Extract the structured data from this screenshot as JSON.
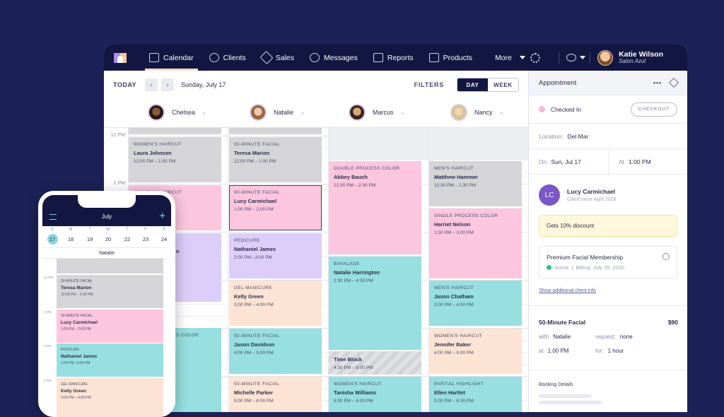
{
  "nav": {
    "items": [
      {
        "label": "Calendar",
        "icon": "calendar-icon",
        "active": true
      },
      {
        "label": "Clients",
        "icon": "clients-icon"
      },
      {
        "label": "Sales",
        "icon": "tag-icon"
      },
      {
        "label": "Messages",
        "icon": "chat-icon"
      },
      {
        "label": "Reports",
        "icon": "bar-chart-icon"
      },
      {
        "label": "Products",
        "icon": "shopping-bag-icon"
      }
    ],
    "more_label": "More",
    "user": {
      "name": "Katie Wilson",
      "salon": "Salon Azul"
    }
  },
  "toolbar": {
    "today_label": "TODAY",
    "prev_icon": "chevron-left-icon",
    "next_icon": "chevron-right-icon",
    "date": "Sunday, July 17",
    "filters_label": "FILTERS",
    "view_day": "DAY",
    "view_week": "WEEK",
    "selected_view": "DAY"
  },
  "staff": [
    "Chelsea",
    "Natalie",
    "Marcus",
    "Nancy"
  ],
  "time_labels": [
    "12 PM",
    "1 PM"
  ],
  "appointments": {
    "chelsea": [
      {
        "service": "Women's Haircut",
        "client": "Laura Johnson",
        "time": "12:00 PM – 1:00 PM"
      },
      {
        "service": "Women's Haircut",
        "client": "",
        "time": ""
      },
      {
        "service": "",
        "client": "n",
        "time": ""
      },
      {
        "service": "s Color",
        "client": "",
        "time": ""
      }
    ],
    "natalie": [
      {
        "service": "50-Minute Facial",
        "client": "Teresa Marion",
        "time": "12:00 PM – 1:00 PM"
      },
      {
        "service": "50-Minute Facial",
        "client": "Lucy Carmichael",
        "time": "1:00 PM – 2:00 PM"
      },
      {
        "service": "Pedicure",
        "client": "Nathaniel James",
        "time": "2:00 PM –3:00 PM"
      },
      {
        "service": "Gel Manicure",
        "client": "Kelly Green",
        "time": "3:00 PM – 4:00 PM"
      },
      {
        "service": "50-Minute Facial",
        "client": "Jason Davidson",
        "time": "4:00 PM – 5:00 PM"
      },
      {
        "service": "50-Minute Facial",
        "client": "Michelle Parker",
        "time": "5:00 PM – 6:00 PM"
      }
    ],
    "marcus": [
      {
        "service": "Double Process Color",
        "client": "Abbey Bauch",
        "time": "12:30 PM – 2:30 PM"
      },
      {
        "service": "Bayalage",
        "client": "Natalie Harrington",
        "time": "2:30 PM – 4:30 PM"
      },
      {
        "service": "",
        "client": "Time Block",
        "time": "4:30 PM – 5:00 PM"
      },
      {
        "service": "Women's Haircut",
        "client": "Tanisha Williams",
        "time": "5:00 PM – 6:00 PM"
      }
    ],
    "nancy": [
      {
        "service": "Men's Haircut",
        "client": "Matthew Hammer",
        "time": "12:30 PM – 1:30 PM"
      },
      {
        "service": "Single Process Color",
        "client": "Harriet Nelson",
        "time": "1:30 PM – 3:00 PM"
      },
      {
        "service": "Men's Haircut",
        "client": "Jason Chatham",
        "time": "3:00 PM – 4:00 PM"
      },
      {
        "service": "Women's Haircut",
        "client": "Jennifer Baker",
        "time": "4:00 PM – 5:00 PM"
      },
      {
        "service": "Partial Highlight",
        "client": "Ellen Hartlet",
        "time": "5:00 PM – 6:30 PM"
      }
    ]
  },
  "panel": {
    "title": "Appointment",
    "more_icon": "ellipsis-icon",
    "edit_icon": "pencil-icon",
    "status": "Checked In",
    "status_color": "#fcb8d4",
    "checkout_label": "CHECKOUT",
    "location_label": "Location:",
    "location": "Del Mar",
    "on_label": "On",
    "date": "Sun, Jul 17",
    "at_label": "At",
    "time": "1:00 PM",
    "client": {
      "initials": "LC",
      "name": "Lucy Carmichael",
      "since": "Client since April 2018"
    },
    "discount": "Gets 10% discount",
    "membership": {
      "title": "Premium Facial Membership",
      "status": "Active",
      "sep": "|",
      "billing": "Billing: July 25, 2020"
    },
    "more_info_link": "Show additional client info",
    "service": {
      "name": "50-Minute Facial",
      "price": "$90",
      "with_label": "with",
      "with": "Natalie",
      "request_label": "request:",
      "request": "none",
      "at_label": "at",
      "at": "1:00 PM",
      "for_label": "for:",
      "for": "1 hour"
    },
    "booking_title": "Booking Details"
  },
  "phone": {
    "month": "July",
    "days": [
      {
        "l": "S",
        "n": "17",
        "selected": true
      },
      {
        "l": "M",
        "n": "18"
      },
      {
        "l": "T",
        "n": "19"
      },
      {
        "l": "W",
        "n": "20"
      },
      {
        "l": "T",
        "n": "22"
      },
      {
        "l": "F",
        "n": "23"
      },
      {
        "l": "S",
        "n": "24"
      }
    ],
    "staff": "Natalie",
    "time_labels": [
      "12 PM",
      "1 PM",
      "2 PM",
      "3 PM"
    ],
    "appointments": [
      {
        "service": "50-Minute Facial",
        "client": "Teresa Marion",
        "time": "12:00 PM – 1:00 PM"
      },
      {
        "service": "50-Minute Facial",
        "client": "Lucy Carmichael",
        "time": "1:00 PM – 2:00 PM"
      },
      {
        "service": "Pedicure",
        "client": "Nathaniel James",
        "time": "2:00 PM –3:00 PM"
      },
      {
        "service": "Gel Manicure",
        "client": "Kelly Green",
        "time": "3:00 PM – 4:00 PM"
      }
    ]
  }
}
